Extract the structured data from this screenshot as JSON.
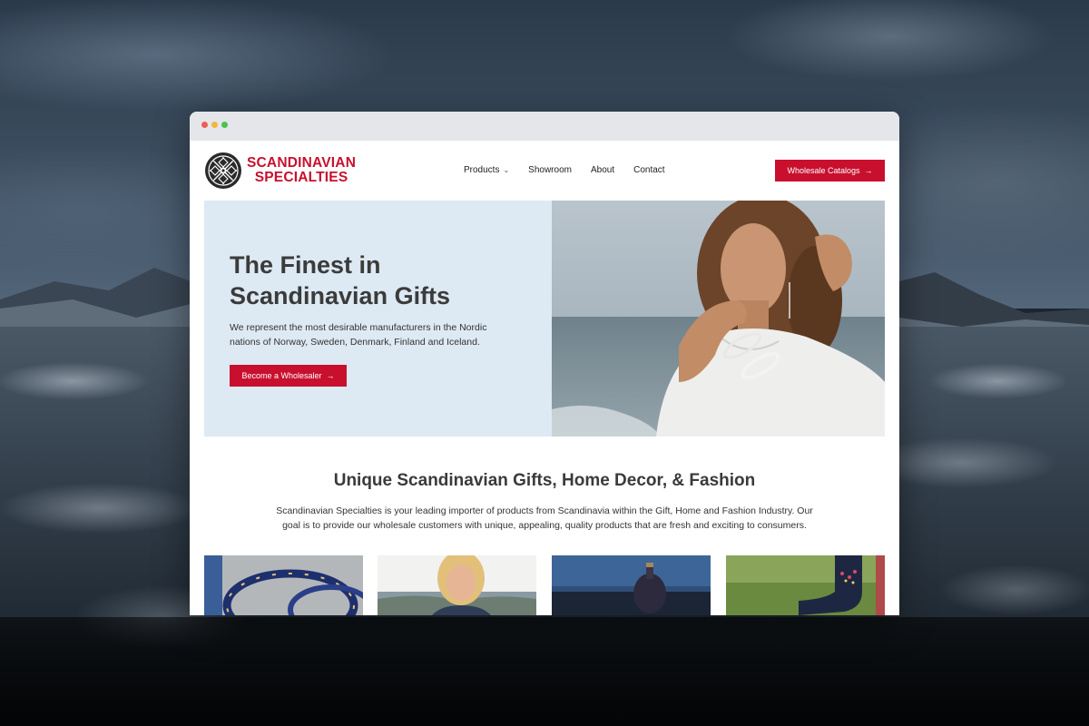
{
  "browser": {
    "window_controls": [
      "close",
      "minimize",
      "maximize"
    ]
  },
  "brand": {
    "name_line1": "SCANDINAVIAN",
    "name_line2": "SPECIALTIES",
    "color": "#c8102e"
  },
  "nav": {
    "items": [
      {
        "label": "Products",
        "has_dropdown": true
      },
      {
        "label": "Showroom"
      },
      {
        "label": "About"
      },
      {
        "label": "Contact"
      }
    ],
    "cta_label": "Wholesale Catalogs",
    "cta_icon": "arrow-right-icon"
  },
  "hero": {
    "title": "The Finest in Scandinavian Gifts",
    "text": "We represent the most desirable manufacturers in the Nordic nations of Norway, Sweden, Denmark, Finland and Iceland.",
    "button_label": "Become a Wholesaler",
    "button_icon": "arrow-right-icon",
    "background_color": "#dde9f3"
  },
  "intro": {
    "title": "Unique Scandinavian Gifts, Home Decor, & Fashion",
    "text": "Scandinavian Specialties is your leading importer of products from Scandinavia within the Gift, Home and Fashion Industry. Our goal is to provide our wholesale customers with unique, appealing, quality products that are fresh and exciting to consumers."
  },
  "tiles": [
    {
      "image": "bracelets"
    },
    {
      "image": "woman-portrait"
    },
    {
      "image": "home-decor-vase"
    },
    {
      "image": "embroidered-socks"
    }
  ],
  "arrow_glyph": "→",
  "chevron_glyph": "⌄"
}
